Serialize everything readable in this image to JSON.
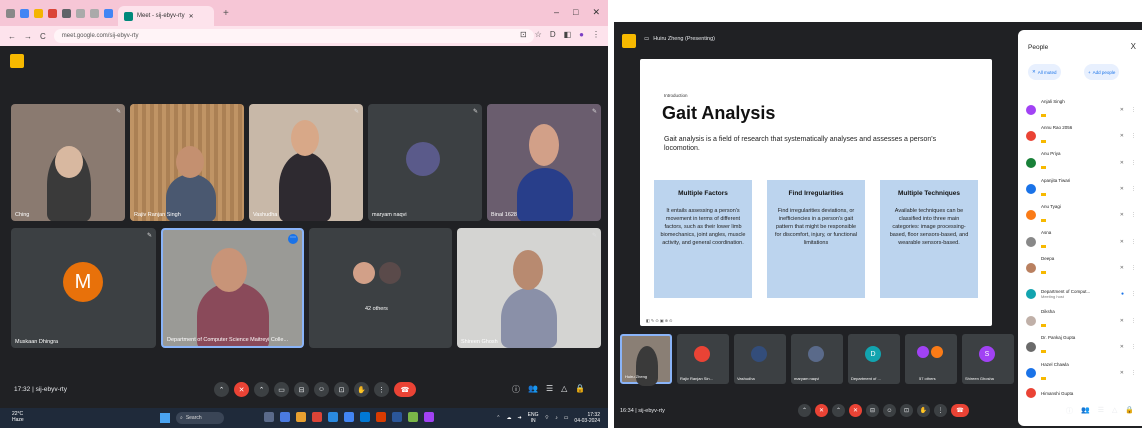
{
  "left": {
    "browser": {
      "tab_title": "Meet - sij-ebyv-rty",
      "tab_plus": "+",
      "window_controls": [
        "–",
        "□",
        "✕"
      ],
      "url": "meet.google.com/sij-ebyv-rty"
    },
    "tiles": [
      {
        "name": "Ching",
        "color": "#8a7a70"
      },
      {
        "name": "Rajiv Ranjan Singh",
        "color": "#a97a52"
      },
      {
        "name": "Vashudha",
        "color": "#c8b8a8"
      },
      {
        "name": "maryam naqvi",
        "color": "#3c4043"
      },
      {
        "name": "Binal 1628",
        "color": "#6a5d6e"
      },
      {
        "name": "Muskaan Dhingra",
        "color": "#3c4043"
      },
      {
        "name": "Department of Computer Science Maitreyi Colle...",
        "color": "#9a9a96"
      },
      {
        "name": "42 others",
        "color": "#3c4043"
      },
      {
        "name": "Shireen Ghosh",
        "color": "#d4d4d2"
      }
    ],
    "muskaan_initial": "M",
    "others_label": "42 others",
    "meeting_id": "17:32  |  sij-ebyv-rty",
    "taskbar": {
      "weather_temp": "22°C",
      "weather_desc": "Haze",
      "search_label": "Search",
      "lang": "ENG",
      "region": "IN",
      "time": "17:32",
      "date": "04-03-2024"
    },
    "brand_colors": {
      "red": "#ea4335",
      "blue": "#1a73e8",
      "keep": "#f7b900"
    }
  },
  "right": {
    "presenter": "Huiru Zheng (Presenting)",
    "slide": {
      "intro": "Introduction",
      "title": "Gait Analysis",
      "description": "Gait analysis is a field of research that systematically analyses and assesses a person's locomotion.",
      "cards": [
        {
          "title": "Multiple Factors",
          "text": "It entails assessing a person's movement in terms of different factors, such as their lower limb biomechanics, joint angles, muscle activity, and general coordination."
        },
        {
          "title": "Find Irregularities",
          "text": "Find irregularities deviations, or inefficiencies in a person's gait pattern that might be responsible for discomfort, injury, or functional limitations"
        },
        {
          "title": "Multiple Techniques",
          "text": "Available techniques can be classified into three main categories: image processing-based, floor sensors-based, and wearable sensors-based."
        }
      ]
    },
    "people_panel": {
      "title": "People",
      "close": "X",
      "all_muted": "All muted",
      "add_people": "Add people",
      "list": [
        {
          "name": "Anjali Singh",
          "color": "#a142f4"
        },
        {
          "name": "Annu Rao 2056",
          "color": "#ea4335"
        },
        {
          "name": "Anu Priya",
          "color": "#188038"
        },
        {
          "name": "Apanjita Tiwari",
          "color": "#1a73e8"
        },
        {
          "name": "Anu Tyagi",
          "color": "#fa7b17"
        },
        {
          "name": "Asna",
          "color": "#888888"
        },
        {
          "name": "Deepa",
          "color": "#b98060"
        },
        {
          "name": "Department of Comput...",
          "color": "#12a4af"
        },
        {
          "name": "Diksha",
          "color": "#c0b0a8"
        },
        {
          "name": "Dr. Pankaj Gupta",
          "color": "#6a6a6a"
        },
        {
          "name": "Hazel Chawla",
          "color": "#1a73e8"
        },
        {
          "name": "Himanshi Gupta",
          "color": "#ea4335"
        }
      ],
      "host_sub": "Meeting host"
    },
    "tiles": [
      {
        "name": "Huiru Zheng",
        "initial": "",
        "color": "#8a7f75"
      },
      {
        "name": "Rajiv Ranjan Sin...",
        "initial": "",
        "color": "#ea4335"
      },
      {
        "name": "Vashudha",
        "initial": "",
        "color": "#334d7a"
      },
      {
        "name": "maryam naqvi",
        "initial": "",
        "color": "#5a6a8a"
      },
      {
        "name": "Department of ...",
        "initial": "D",
        "color": "#12a4af"
      },
      {
        "name": "57 others",
        "initial": "",
        "color": "#3c4043"
      },
      {
        "name": "Shireen Ghosha",
        "initial": "S",
        "color": "#a142f4"
      }
    ],
    "meeting_id": "16:34  |  sij-ebyv-rty"
  }
}
